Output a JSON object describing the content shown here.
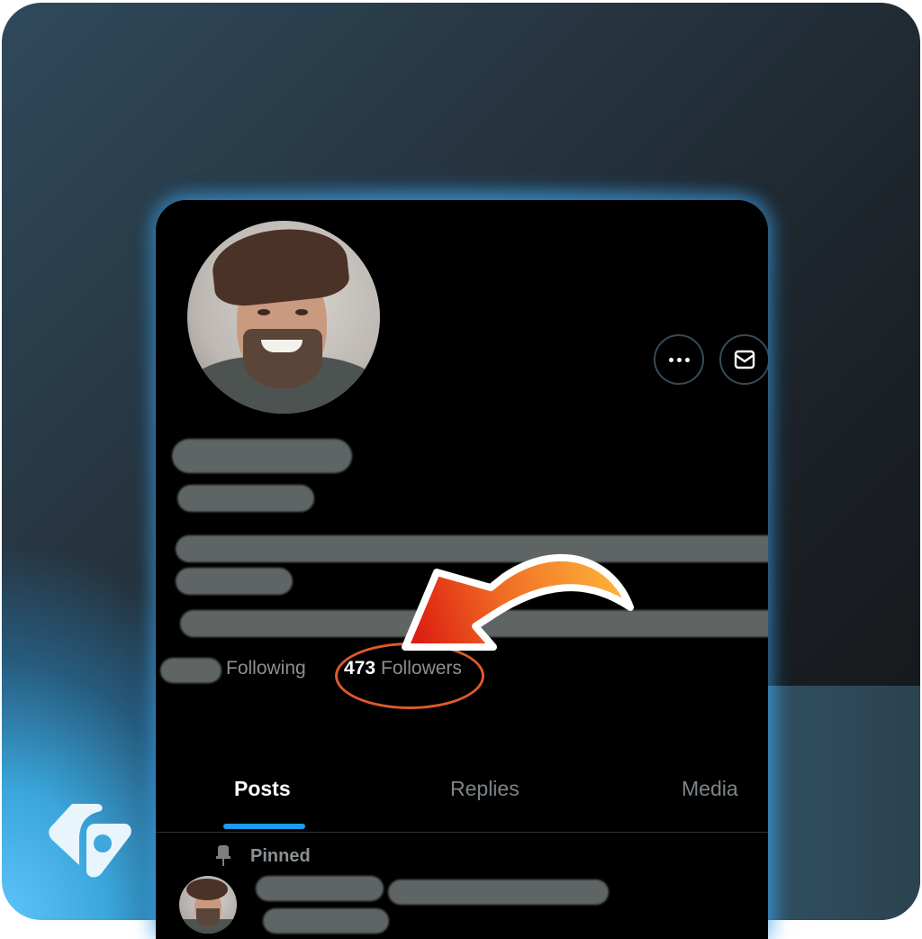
{
  "profile": {
    "more_icon": "more-horizontal-icon",
    "message_icon": "mail-icon"
  },
  "stats": {
    "following_label": "Following",
    "followers_count": "473",
    "followers_label": "Followers"
  },
  "tabs": [
    {
      "label": "Posts",
      "active": true
    },
    {
      "label": "Replies",
      "active": false
    },
    {
      "label": "Media",
      "active": false
    }
  ],
  "feed": {
    "pinned_label": "Pinned",
    "pin_icon": "pin-icon"
  },
  "annotation": {
    "highlight_color": "#e05a2a",
    "arrow_gradient": [
      "#d9120f",
      "#f06a23",
      "#ffb93d"
    ],
    "accent_color": "#1d9bf0"
  },
  "brand": {
    "logo_icon": "brand-logo-icon"
  }
}
